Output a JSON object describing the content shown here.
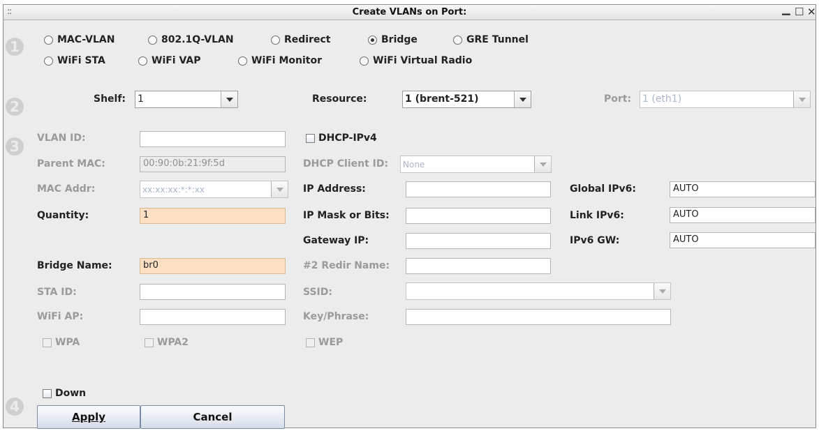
{
  "window": {
    "title": "Create VLANs on Port:",
    "grip": "::",
    "minimize_icon": "minimize-icon",
    "maximize_icon": "maximize-icon",
    "close_icon": "close-icon"
  },
  "steps": [
    "1",
    "2",
    "3",
    "4"
  ],
  "port_type": {
    "options": [
      "MAC-VLAN",
      "802.1Q-VLAN",
      "Redirect",
      "Bridge",
      "GRE Tunnel",
      "WiFi STA",
      "WiFi VAP",
      "WiFi Monitor",
      "WiFi Virtual Radio"
    ],
    "selected": "Bridge"
  },
  "location": {
    "shelf_label": "Shelf:",
    "shelf_value": "1",
    "resource_label": "Resource:",
    "resource_value": "1 (brent-521)",
    "port_label": "Port:",
    "port_value": "1 (eth1)"
  },
  "config": {
    "vlan_id_label": "VLAN ID:",
    "vlan_id_value": "",
    "parent_mac_label": "Parent MAC:",
    "parent_mac_value": "00:90:0b:21:9f:5d",
    "mac_addr_label": "MAC Addr:",
    "mac_addr_value": "xx:xx:xx:*:*:xx",
    "quantity_label": "Quantity:",
    "quantity_value": "1",
    "bridge_name_label": "Bridge Name:",
    "bridge_name_value": "br0",
    "sta_id_label": "STA ID:",
    "sta_id_value": "",
    "wifi_ap_label": "WiFi AP:",
    "wifi_ap_value": "",
    "wpa_label": "WPA",
    "wpa2_label": "WPA2",
    "wep_label": "WEP",
    "dhcp_ipv4_label": "DHCP-IPv4",
    "dhcp_client_id_label": "DHCP Client ID:",
    "dhcp_client_id_value": "None",
    "ip_address_label": "IP Address:",
    "ip_address_value": "",
    "ip_mask_label": "IP Mask or Bits:",
    "ip_mask_value": "",
    "gateway_ip_label": "Gateway IP:",
    "gateway_ip_value": "",
    "redir_name_label": "#2 Redir Name:",
    "redir_name_value": "",
    "ssid_label": "SSID:",
    "ssid_value": "",
    "key_phrase_label": "Key/Phrase:",
    "key_phrase_value": "",
    "global_ipv6_label": "Global IPv6:",
    "global_ipv6_value": "AUTO",
    "link_ipv6_label": "Link IPv6:",
    "link_ipv6_value": "AUTO",
    "ipv6_gw_label": "IPv6 GW:",
    "ipv6_gw_value": "AUTO"
  },
  "footer": {
    "down_label": "Down",
    "apply_label": "Apply",
    "cancel_label": "Cancel"
  }
}
